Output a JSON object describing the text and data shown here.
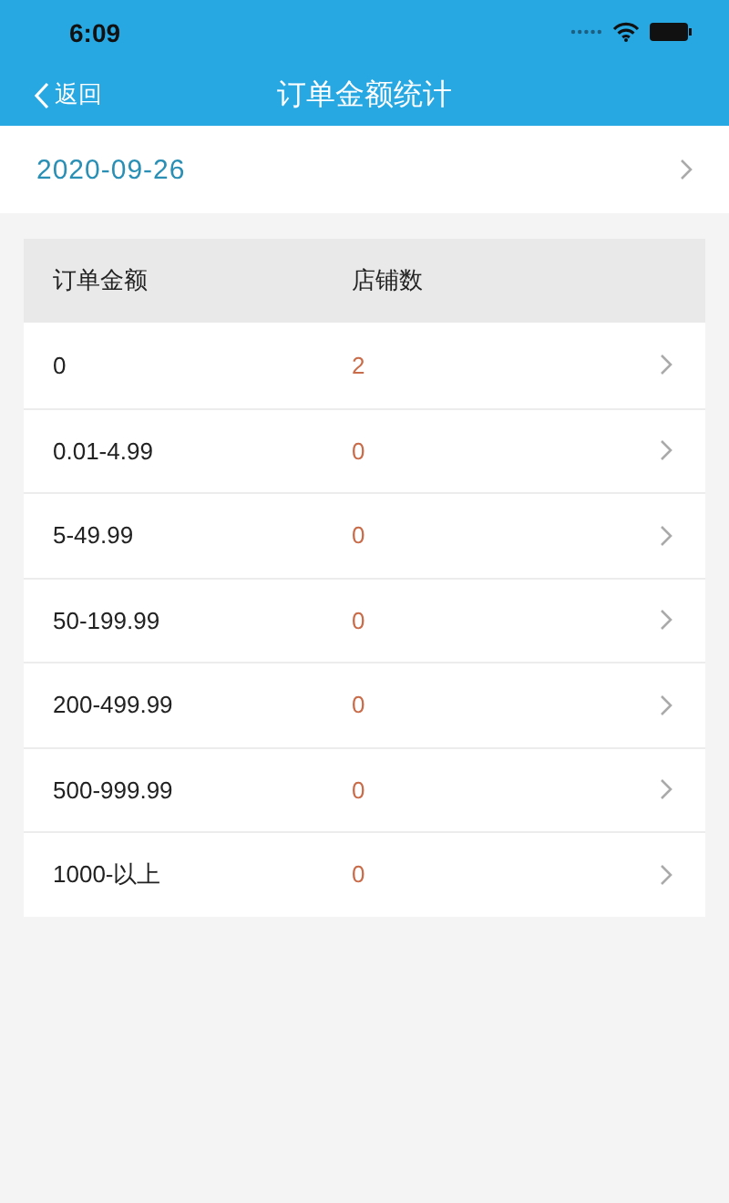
{
  "status_bar": {
    "time": "6:09"
  },
  "nav_bar": {
    "back": "返回",
    "title": "订单金额统计"
  },
  "date_row": {
    "date": "2020-09-26"
  },
  "table": {
    "columns": [
      "订单金额",
      "店铺数"
    ],
    "rows": [
      {
        "amount": "0",
        "stores": "2"
      },
      {
        "amount": "0.01-4.99",
        "stores": "0"
      },
      {
        "amount": "5-49.99",
        "stores": "0"
      },
      {
        "amount": "50-199.99",
        "stores": "0"
      },
      {
        "amount": "200-499.99",
        "stores": "0"
      },
      {
        "amount": "500-999.99",
        "stores": "0"
      },
      {
        "amount": "1000-以上",
        "stores": "0"
      }
    ]
  }
}
